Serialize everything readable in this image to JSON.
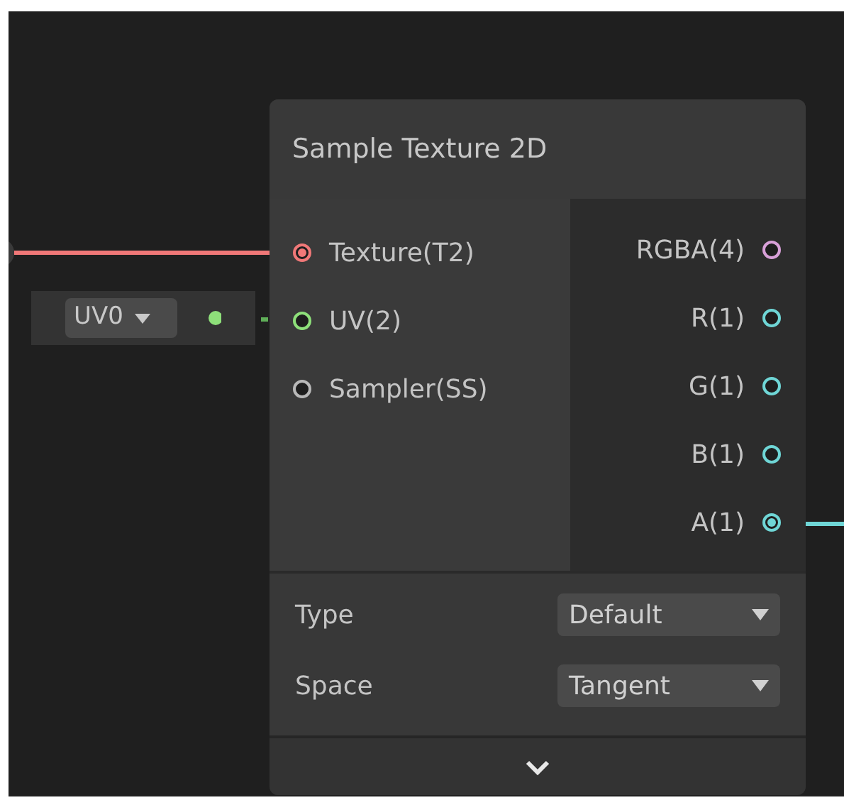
{
  "node": {
    "title": "Sample Texture 2D",
    "inputs": [
      {
        "label": "Texture(T2)",
        "color": "#f07878",
        "connected": true
      },
      {
        "label": "UV(2)",
        "color": "#8ee07a",
        "connected": false
      },
      {
        "label": "Sampler(SS)",
        "color": "#b8b8b8",
        "connected": false
      }
    ],
    "outputs": [
      {
        "label": "RGBA(4)",
        "color": "#d8a0d8",
        "connected": false
      },
      {
        "label": "R(1)",
        "color": "#6fd6d6",
        "connected": false
      },
      {
        "label": "G(1)",
        "color": "#6fd6d6",
        "connected": false
      },
      {
        "label": "B(1)",
        "color": "#6fd6d6",
        "connected": false
      },
      {
        "label": "A(1)",
        "color": "#6fd6d6",
        "connected": true
      }
    ],
    "settings": [
      {
        "label": "Type",
        "value": "Default"
      },
      {
        "label": "Space",
        "value": "Tangent"
      }
    ]
  },
  "uv_node": {
    "value": "UV0"
  }
}
